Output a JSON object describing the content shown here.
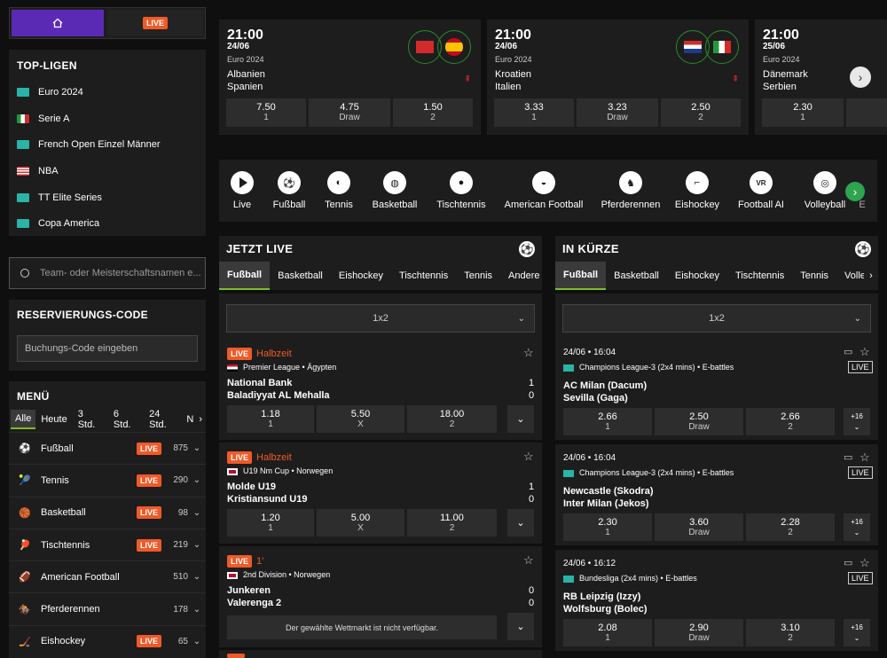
{
  "nav": {
    "live_label": "LIVE"
  },
  "top_leagues": {
    "title": "TOP-LIGEN",
    "items": [
      {
        "label": "Euro 2024",
        "icon": "globe-icon"
      },
      {
        "label": "Serie A",
        "icon": "italy-flag-icon"
      },
      {
        "label": "French Open Einzel Männer",
        "icon": "globe-icon"
      },
      {
        "label": "NBA",
        "icon": "usa-flag-icon"
      },
      {
        "label": "TT Elite Series",
        "icon": "globe-icon"
      },
      {
        "label": "Copa America",
        "icon": "globe-icon"
      }
    ]
  },
  "search": {
    "placeholder": "Team- oder Meisterschaftsnamen e..."
  },
  "reservation": {
    "title": "RESERVIERUNGS-CODE",
    "placeholder": "Buchungs-Code eingeben"
  },
  "menu": {
    "title": "MENÜ",
    "filters": [
      "Alle",
      "Heute",
      "3 Std.",
      "6 Std.",
      "24 Std.",
      "N"
    ],
    "sports": [
      {
        "label": "Fußball",
        "live": "LIVE",
        "count": "875"
      },
      {
        "label": "Tennis",
        "live": "LIVE",
        "count": "290"
      },
      {
        "label": "Basketball",
        "live": "LIVE",
        "count": "98"
      },
      {
        "label": "Tischtennis",
        "live": "LIVE",
        "count": "219"
      },
      {
        "label": "American Football",
        "live": "",
        "count": "510"
      },
      {
        "label": "Pferderennen",
        "live": "",
        "count": "178"
      },
      {
        "label": "Eishockey",
        "live": "LIVE",
        "count": "65"
      }
    ]
  },
  "featured": [
    {
      "time": "21:00",
      "date": "24/06",
      "comp": "Euro 2024",
      "team1": "Albanien",
      "team2": "Spanien",
      "odds": [
        {
          "v": "7.50",
          "l": "1"
        },
        {
          "v": "4.75",
          "l": "Draw"
        },
        {
          "v": "1.50",
          "l": "2"
        }
      ]
    },
    {
      "time": "21:00",
      "date": "24/06",
      "comp": "Euro 2024",
      "team1": "Kroatien",
      "team2": "Italien",
      "odds": [
        {
          "v": "3.33",
          "l": "1"
        },
        {
          "v": "3.23",
          "l": "Draw"
        },
        {
          "v": "2.50",
          "l": "2"
        }
      ]
    },
    {
      "time": "21:00",
      "date": "25/06",
      "comp": "Euro 2024",
      "team1": "Dänemark",
      "team2": "Serbien",
      "odds": [
        {
          "v": "2.30",
          "l": "1"
        }
      ]
    }
  ],
  "sports_bar": [
    "Live",
    "Fußball",
    "Tennis",
    "Basketball",
    "Tischtennis",
    "American Football",
    "Pferderennen",
    "Eishockey",
    "Football AI",
    "Volleyball",
    "E"
  ],
  "live": {
    "title": "JETZT LIVE",
    "tabs": [
      "Fußball",
      "Basketball",
      "Eishockey",
      "Tischtennis",
      "Tennis",
      "Andere"
    ],
    "market": "1x2",
    "events": [
      {
        "live": "LIVE",
        "status": "Halbzeit",
        "league": "Premier League • Ägypten",
        "team1": "National Bank",
        "team2": "Baladiyyat AL Mehalla",
        "s1": "1",
        "s2": "0",
        "odds": [
          {
            "v": "1.18",
            "l": "1"
          },
          {
            "v": "5.50",
            "l": "X"
          },
          {
            "v": "18.00",
            "l": "2"
          }
        ]
      },
      {
        "live": "LIVE",
        "status": "Halbzeit",
        "league": "U19 Nm Cup • Norwegen",
        "team1": "Molde U19",
        "team2": "Kristiansund U19",
        "s1": "1",
        "s2": "0",
        "odds": [
          {
            "v": "1.20",
            "l": "1"
          },
          {
            "v": "5.00",
            "l": "X"
          },
          {
            "v": "11.00",
            "l": "2"
          }
        ]
      },
      {
        "live": "LIVE",
        "status": "1'",
        "league": "2nd Division • Norwegen",
        "team1": "Junkeren",
        "team2": "Valerenga 2",
        "s1": "0",
        "s2": "0",
        "unavailable": "Der gewählte Wettmarkt ist nicht verfügbar."
      }
    ]
  },
  "soon": {
    "title": "IN KÜRZE",
    "tabs": [
      "Fußball",
      "Basketball",
      "Eishockey",
      "Tischtennis",
      "Tennis",
      "Volleyt"
    ],
    "market": "1x2",
    "events": [
      {
        "datetime": "24/06 • 16:04",
        "league": "Champions League-3 (2x4 mins) • E-battles",
        "team1": "AC Milan (Dacum)",
        "team2": "Sevilla (Gaga)",
        "odds": [
          {
            "v": "2.66",
            "l": "1"
          },
          {
            "v": "2.50",
            "l": "Draw"
          },
          {
            "v": "2.66",
            "l": "2"
          }
        ],
        "more": "+16"
      },
      {
        "datetime": "24/06 • 16:04",
        "league": "Champions League-3 (2x4 mins) • E-battles",
        "team1": "Newcastle (Skodra)",
        "team2": "Inter Milan (Jekos)",
        "odds": [
          {
            "v": "2.30",
            "l": "1"
          },
          {
            "v": "3.60",
            "l": "Draw"
          },
          {
            "v": "2.28",
            "l": "2"
          }
        ],
        "more": "+16"
      },
      {
        "datetime": "24/06 • 16:12",
        "league": "Bundesliga (2x4 mins) • E-battles",
        "team1": "RB Leipzig (Izzy)",
        "team2": "Wolfsburg (Bolec)",
        "odds": [
          {
            "v": "2.08",
            "l": "1"
          },
          {
            "v": "2.90",
            "l": "Draw"
          },
          {
            "v": "3.10",
            "l": "2"
          }
        ],
        "more": "+16"
      }
    ],
    "live_label": "LIVE"
  }
}
